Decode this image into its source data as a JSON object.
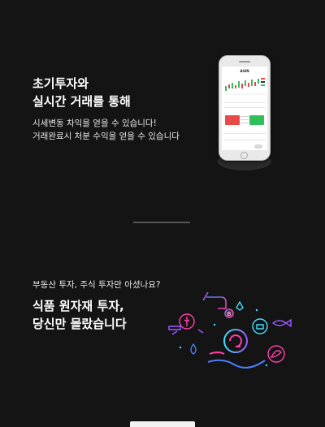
{
  "section1": {
    "title_lines": [
      "초기투자와",
      "실시간 거래를 통해"
    ],
    "desc_lines": [
      "시세변동 차익을 얻을 수 있습니다!",
      "거래완료시 처분 수익을 얻을 수 있습니다"
    ]
  },
  "phone_screen": {
    "app_title": "AGIN"
  },
  "section2": {
    "pre": "부동산 투자, 주식 투자만 아셨나요?",
    "title_lines": [
      "식품 원자재 투자,",
      "당신만 몰랐습니다"
    ]
  },
  "colors": {
    "background": "#141414",
    "text": "#ffffff",
    "sell": "#e84a4a",
    "buy": "#2fc05a",
    "neon_pink": "#ff3fa8",
    "neon_blue": "#4d7dff",
    "neon_purple": "#9b5cff",
    "neon_cyan": "#3ee0ff"
  },
  "icons": [
    "hand-coin-icon",
    "bitcoin-icon",
    "ethereum-icon",
    "wheat-icon",
    "fish-icon",
    "drop-icon",
    "cow-icon",
    "leaf-icon",
    "coffee-icon",
    "hand-token-icon"
  ]
}
